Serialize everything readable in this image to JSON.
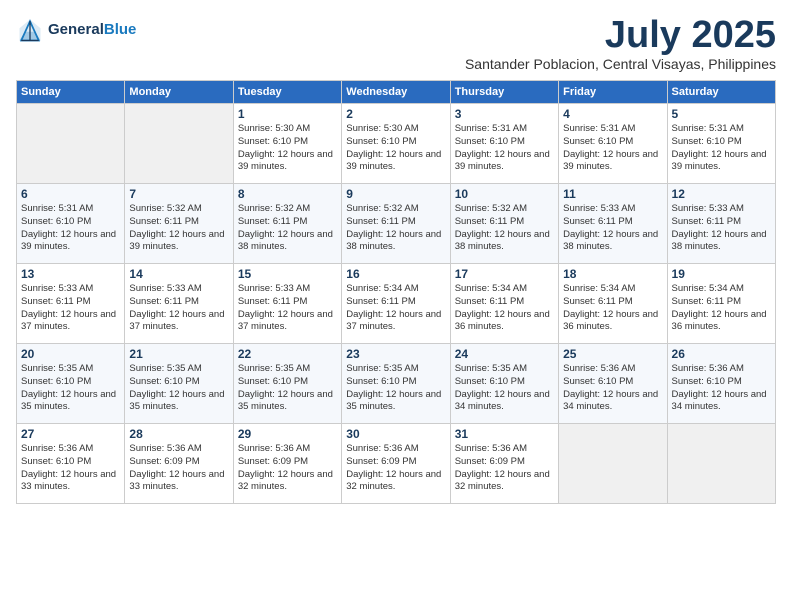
{
  "header": {
    "logo_line1": "General",
    "logo_line2": "Blue",
    "month": "July 2025",
    "location": "Santander Poblacion, Central Visayas, Philippines"
  },
  "weekdays": [
    "Sunday",
    "Monday",
    "Tuesday",
    "Wednesday",
    "Thursday",
    "Friday",
    "Saturday"
  ],
  "weeks": [
    [
      {
        "day": "",
        "info": ""
      },
      {
        "day": "",
        "info": ""
      },
      {
        "day": "1",
        "info": "Sunrise: 5:30 AM\nSunset: 6:10 PM\nDaylight: 12 hours and 39 minutes."
      },
      {
        "day": "2",
        "info": "Sunrise: 5:30 AM\nSunset: 6:10 PM\nDaylight: 12 hours and 39 minutes."
      },
      {
        "day": "3",
        "info": "Sunrise: 5:31 AM\nSunset: 6:10 PM\nDaylight: 12 hours and 39 minutes."
      },
      {
        "day": "4",
        "info": "Sunrise: 5:31 AM\nSunset: 6:10 PM\nDaylight: 12 hours and 39 minutes."
      },
      {
        "day": "5",
        "info": "Sunrise: 5:31 AM\nSunset: 6:10 PM\nDaylight: 12 hours and 39 minutes."
      }
    ],
    [
      {
        "day": "6",
        "info": "Sunrise: 5:31 AM\nSunset: 6:10 PM\nDaylight: 12 hours and 39 minutes."
      },
      {
        "day": "7",
        "info": "Sunrise: 5:32 AM\nSunset: 6:11 PM\nDaylight: 12 hours and 39 minutes."
      },
      {
        "day": "8",
        "info": "Sunrise: 5:32 AM\nSunset: 6:11 PM\nDaylight: 12 hours and 38 minutes."
      },
      {
        "day": "9",
        "info": "Sunrise: 5:32 AM\nSunset: 6:11 PM\nDaylight: 12 hours and 38 minutes."
      },
      {
        "day": "10",
        "info": "Sunrise: 5:32 AM\nSunset: 6:11 PM\nDaylight: 12 hours and 38 minutes."
      },
      {
        "day": "11",
        "info": "Sunrise: 5:33 AM\nSunset: 6:11 PM\nDaylight: 12 hours and 38 minutes."
      },
      {
        "day": "12",
        "info": "Sunrise: 5:33 AM\nSunset: 6:11 PM\nDaylight: 12 hours and 38 minutes."
      }
    ],
    [
      {
        "day": "13",
        "info": "Sunrise: 5:33 AM\nSunset: 6:11 PM\nDaylight: 12 hours and 37 minutes."
      },
      {
        "day": "14",
        "info": "Sunrise: 5:33 AM\nSunset: 6:11 PM\nDaylight: 12 hours and 37 minutes."
      },
      {
        "day": "15",
        "info": "Sunrise: 5:33 AM\nSunset: 6:11 PM\nDaylight: 12 hours and 37 minutes."
      },
      {
        "day": "16",
        "info": "Sunrise: 5:34 AM\nSunset: 6:11 PM\nDaylight: 12 hours and 37 minutes."
      },
      {
        "day": "17",
        "info": "Sunrise: 5:34 AM\nSunset: 6:11 PM\nDaylight: 12 hours and 36 minutes."
      },
      {
        "day": "18",
        "info": "Sunrise: 5:34 AM\nSunset: 6:11 PM\nDaylight: 12 hours and 36 minutes."
      },
      {
        "day": "19",
        "info": "Sunrise: 5:34 AM\nSunset: 6:11 PM\nDaylight: 12 hours and 36 minutes."
      }
    ],
    [
      {
        "day": "20",
        "info": "Sunrise: 5:35 AM\nSunset: 6:10 PM\nDaylight: 12 hours and 35 minutes."
      },
      {
        "day": "21",
        "info": "Sunrise: 5:35 AM\nSunset: 6:10 PM\nDaylight: 12 hours and 35 minutes."
      },
      {
        "day": "22",
        "info": "Sunrise: 5:35 AM\nSunset: 6:10 PM\nDaylight: 12 hours and 35 minutes."
      },
      {
        "day": "23",
        "info": "Sunrise: 5:35 AM\nSunset: 6:10 PM\nDaylight: 12 hours and 35 minutes."
      },
      {
        "day": "24",
        "info": "Sunrise: 5:35 AM\nSunset: 6:10 PM\nDaylight: 12 hours and 34 minutes."
      },
      {
        "day": "25",
        "info": "Sunrise: 5:36 AM\nSunset: 6:10 PM\nDaylight: 12 hours and 34 minutes."
      },
      {
        "day": "26",
        "info": "Sunrise: 5:36 AM\nSunset: 6:10 PM\nDaylight: 12 hours and 34 minutes."
      }
    ],
    [
      {
        "day": "27",
        "info": "Sunrise: 5:36 AM\nSunset: 6:10 PM\nDaylight: 12 hours and 33 minutes."
      },
      {
        "day": "28",
        "info": "Sunrise: 5:36 AM\nSunset: 6:09 PM\nDaylight: 12 hours and 33 minutes."
      },
      {
        "day": "29",
        "info": "Sunrise: 5:36 AM\nSunset: 6:09 PM\nDaylight: 12 hours and 32 minutes."
      },
      {
        "day": "30",
        "info": "Sunrise: 5:36 AM\nSunset: 6:09 PM\nDaylight: 12 hours and 32 minutes."
      },
      {
        "day": "31",
        "info": "Sunrise: 5:36 AM\nSunset: 6:09 PM\nDaylight: 12 hours and 32 minutes."
      },
      {
        "day": "",
        "info": ""
      },
      {
        "day": "",
        "info": ""
      }
    ]
  ]
}
